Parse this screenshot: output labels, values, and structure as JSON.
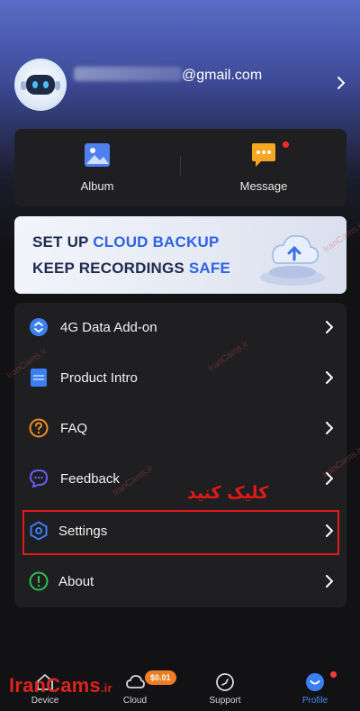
{
  "header": {
    "email_suffix": "@gmail.com"
  },
  "quick_actions": [
    {
      "label": "Album",
      "icon": "image-icon"
    },
    {
      "label": "Message",
      "icon": "message-icon",
      "has_notification": true
    }
  ],
  "banner": {
    "line1_prefix": "SET UP ",
    "line1_highlight": "CLOUD BACKUP",
    "line2_prefix": "KEEP RECORDINGS ",
    "line2_highlight": "SAFE"
  },
  "menu": [
    {
      "label": "4G Data Add-on",
      "icon": "data-addon-icon",
      "color": "#3b7ff5"
    },
    {
      "label": "Product Intro",
      "icon": "document-icon",
      "color": "#3b7ff5"
    },
    {
      "label": "FAQ",
      "icon": "question-icon",
      "color": "#f08a24"
    },
    {
      "label": "Feedback",
      "icon": "chat-bubble-icon",
      "color": "#6a5cf5"
    },
    {
      "label": "Settings",
      "icon": "hexagon-settings-icon",
      "color": "#3b7ff5"
    },
    {
      "label": "About",
      "icon": "info-icon",
      "color": "#2ebd4e"
    }
  ],
  "annotation": {
    "text": "کلیک کنید"
  },
  "watermark": {
    "text": "IranCams.ir",
    "logo_main": "IranCams",
    "logo_suffix": ".ir"
  },
  "bottom_nav": [
    {
      "label": "Device",
      "icon": "home-icon"
    },
    {
      "label": "Cloud",
      "icon": "cloud-icon",
      "badge": "$0.01"
    },
    {
      "label": "Support",
      "icon": "compass-icon"
    },
    {
      "label": "Profile",
      "icon": "profile-icon",
      "active": true
    }
  ],
  "colors": {
    "accent": "#4a86f5",
    "highlight": "#e01919",
    "badge": "#f07d22"
  }
}
